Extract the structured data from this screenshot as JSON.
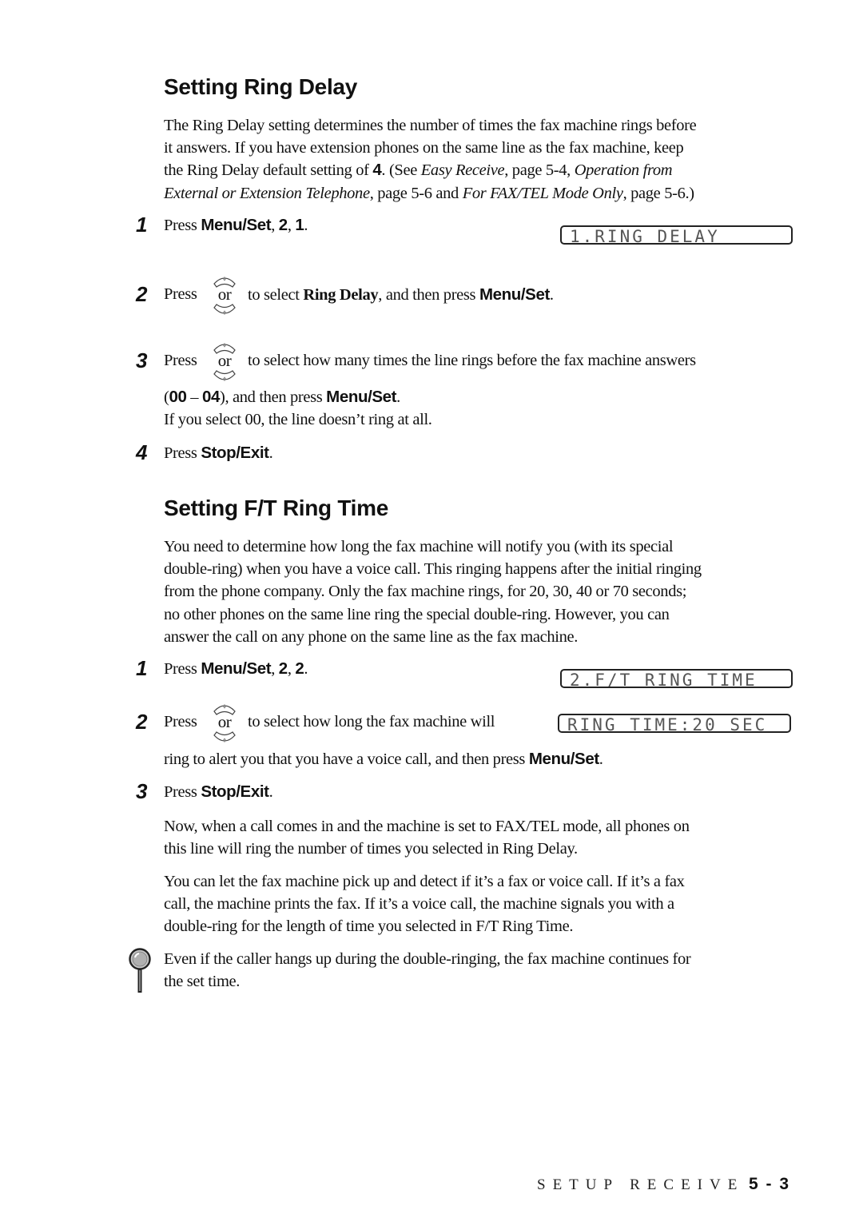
{
  "section1": {
    "heading": "Setting Ring Delay",
    "intro": {
      "l1": "The Ring Delay setting determines the number of times the fax machine rings before",
      "l2": "it answers.  If you have extension phones on the same line as the fax machine, keep",
      "l3a": "the Ring Delay default setting of ",
      "l3b": "4",
      "l3c": ". (See ",
      "l3d": "Easy Receive",
      "l3e": ", page 5-4, ",
      "l3f": "Operation from",
      "l4a": "External or Extension Telephone",
      "l4b": ", page 5-6 and ",
      "l4c": "For FAX/TEL Mode Only",
      "l4d": ", page 5-6.)"
    },
    "steps": [
      {
        "number": "1",
        "press": "Press ",
        "key": "Menu/Set",
        "sep1": ", ",
        "k2": "2",
        "sep2": ", ",
        "k3": "1",
        "end": ".",
        "lcd": "1.RING DELAY"
      },
      {
        "number": "2",
        "press": "Press",
        "or": "or",
        "t1": "to select ",
        "t2": "Ring Delay",
        "t3": ", and then press ",
        "key": "Menu/Set",
        "end": "."
      },
      {
        "number": "3",
        "press": "Press",
        "or": "or",
        "t1": "to select how many times the line rings before the fax machine answers",
        "l2a": "(",
        "l2b": "00",
        "l2c": " – ",
        "l2d": "04",
        "l2e": "), and then press ",
        "l2f": "Menu/Set",
        "l2g": ".",
        "l3": "If you select 00, the line doesn’t ring at all."
      },
      {
        "number": "4",
        "press": "Press ",
        "key": "Stop/Exit",
        "end": "."
      }
    ]
  },
  "section2": {
    "heading": "Setting F/T Ring Time",
    "intro": [
      "You need to determine how long the fax machine will notify you (with its special",
      "double-ring) when you have a voice call.  This ringing happens after the initial ringing",
      "from the phone company.  Only the fax machine rings, for 20, 30, 40 or 70 seconds;",
      "no other phones on the same line ring the special double-ring. However, you can",
      "answer the call on any phone on the same line as the fax machine."
    ],
    "steps": [
      {
        "number": "1",
        "press": "Press ",
        "key": "Menu/Set",
        "sep1": ", ",
        "k2": "2",
        "sep2": ", ",
        "k3": "2",
        "end": ".",
        "lcd": "2.F/T RING TIME"
      },
      {
        "number": "2",
        "press": "Press",
        "or": "or",
        "t1": "to select how long the fax machine will",
        "lcd": "RING TIME:20 SEC",
        "l2a": "ring to alert you that you have a voice call, and then press ",
        "l2b": "Menu/Set",
        "l2c": "."
      },
      {
        "number": "3",
        "press": "Press ",
        "key": "Stop/Exit",
        "end": "."
      }
    ],
    "after1": [
      "Now, when a call comes in and the machine is set to FAX/TEL mode, all phones on",
      "this line will ring the number of times you selected in Ring Delay."
    ],
    "after2": [
      "You can let the fax machine pick up and detect if it’s a fax or voice call. If it’s a fax",
      "call, the machine prints the fax. If it’s a voice call, the machine signals you with a",
      "double-ring for the length of time you selected in F/T Ring Time."
    ],
    "note": {
      "icon": "magnifier-icon",
      "lines": [
        "Even if the caller hangs up during the double-ringing, the fax machine continues for",
        "the set time."
      ]
    }
  },
  "footer": {
    "section": "SETUP RECEIVE",
    "page": "5 - 3"
  }
}
